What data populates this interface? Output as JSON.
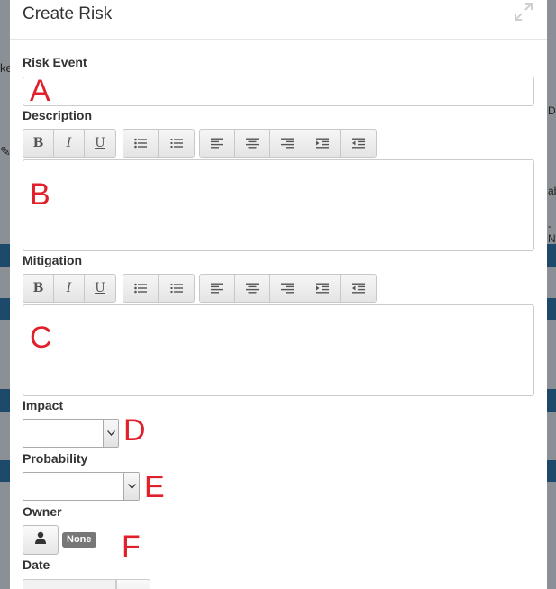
{
  "modal": {
    "title": "Create Risk"
  },
  "background": {
    "left_fragment": "ke",
    "right_fragments": [
      "D",
      "ab",
      "- N"
    ]
  },
  "form": {
    "risk_event": {
      "label": "Risk Event",
      "value": "",
      "annotation": "A"
    },
    "description": {
      "label": "Description",
      "value": "",
      "annotation": "B"
    },
    "mitigation": {
      "label": "Mitigation",
      "value": "",
      "annotation": "C"
    },
    "impact": {
      "label": "Impact",
      "selected": "",
      "annotation": "D"
    },
    "probability": {
      "label": "Probability",
      "selected": "",
      "annotation": "E"
    },
    "owner": {
      "label": "Owner",
      "badge": "None",
      "annotation": "F"
    },
    "date": {
      "label": "Date",
      "value": ""
    }
  },
  "toolbar": {
    "bold": "B",
    "italic": "I",
    "underline": "U",
    "icons": [
      "bulleted-list-icon",
      "numbered-list-icon",
      "align-left-icon",
      "align-center-icon",
      "align-right-icon",
      "indent-icon",
      "outdent-icon"
    ]
  },
  "colors": {
    "annotation": "#e0202a",
    "badge": "#777777",
    "stripe": "#1d4a6b"
  }
}
